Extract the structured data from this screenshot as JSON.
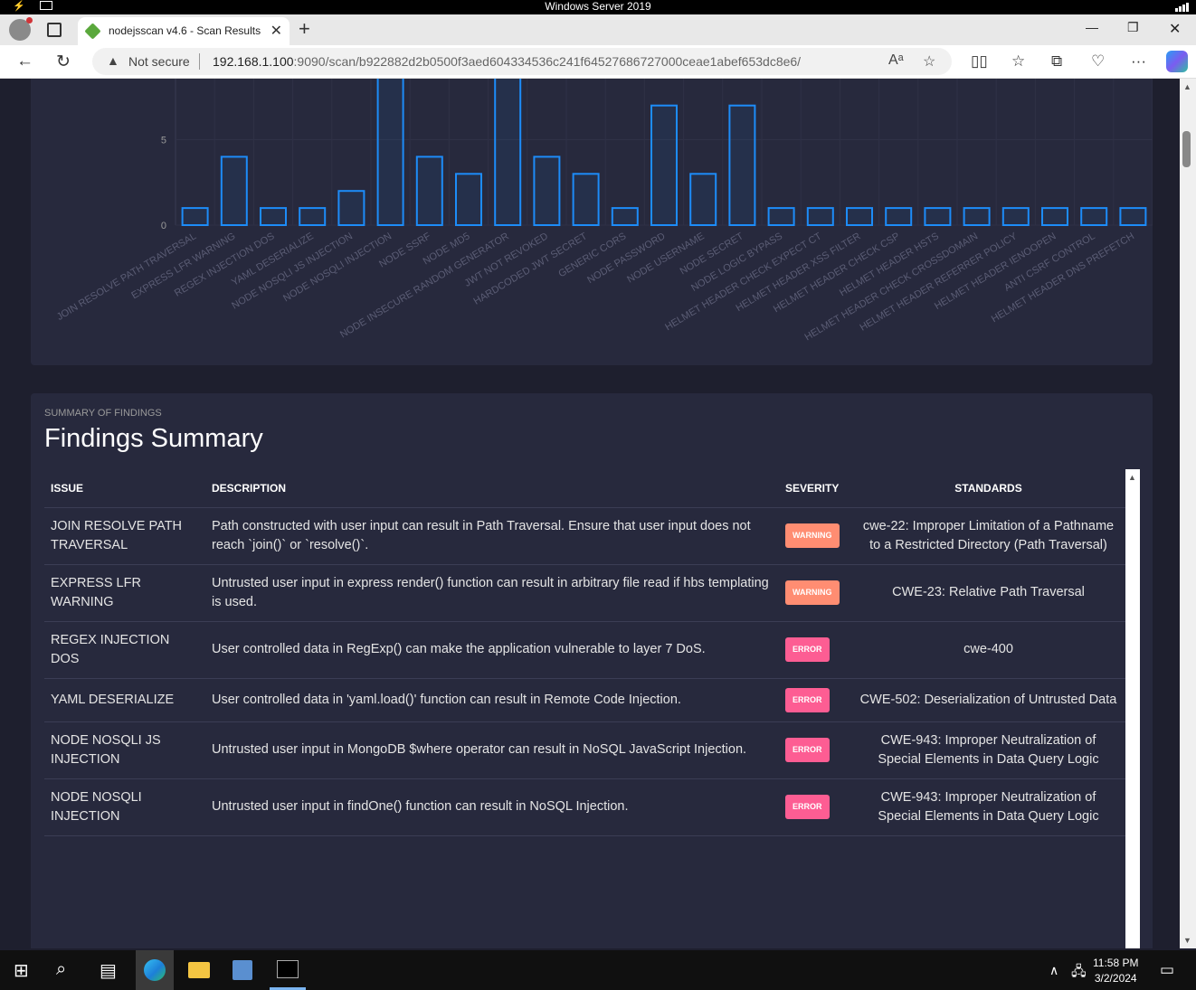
{
  "os": {
    "title": "Windows Server 2019"
  },
  "browser": {
    "tab_title": "nodejsscan v4.6 - Scan Results",
    "not_secure": "Not secure",
    "url_host": "192.168.1.100",
    "url_rest": ":9090/scan/b922882d2b0500f3aed604334536c241f64527686727000ceae1abef653dc8e6/"
  },
  "chart_data": {
    "type": "bar",
    "categories": [
      "JOIN RESOLVE PATH TRAVERSAL",
      "EXPRESS LFR WARNING",
      "REGEX INJECTION DOS",
      "YAML DESERIALIZE",
      "NODE NOSQLI JS INJECTION",
      "NODE NOSQLI INJECTION",
      "NODE SSRF",
      "NODE MD5",
      "NODE INSECURE RANDOM GENERATOR",
      "JWT NOT REVOKED",
      "HARDCODED JWT SECRET",
      "GENERIC CORS",
      "NODE PASSWORD",
      "NODE USERNAME",
      "NODE SECRET",
      "NODE LOGIC BYPASS",
      "HELMET HEADER CHECK EXPECT CT",
      "HELMET HEADER XSS FILTER",
      "HELMET HEADER CHECK CSP",
      "HELMET HEADER HSTS",
      "HELMET HEADER CHECK CROSSDOMAIN",
      "HELMET HEADER REFERRER POLICY",
      "HELMET HEADER IENOOPEN",
      "ANTI CSRF CONTROL",
      "HELMET HEADER DNS PREFETCH"
    ],
    "values": [
      1,
      4,
      1,
      1,
      2,
      9,
      4,
      3,
      9,
      4,
      3,
      1,
      7,
      3,
      7,
      1,
      1,
      1,
      1,
      1,
      1,
      1,
      1,
      1,
      1
    ],
    "y_ticks": [
      "0",
      "5"
    ],
    "ylim": [
      0,
      8.6
    ],
    "bar_color": "#1d8cf8",
    "grid": true
  },
  "summary": {
    "category": "SUMMARY OF FINDINGS",
    "title": "Findings Summary",
    "headers": {
      "issue": "ISSUE",
      "description": "DESCRIPTION",
      "severity": "SEVERITY",
      "standards": "STANDARDS"
    },
    "rows": [
      {
        "issue": "JOIN RESOLVE PATH TRAVERSAL",
        "description": "Path constructed with user input can result in Path Traversal. Ensure that user input does not reach `join()` or `resolve()`.",
        "severity": "WARNING",
        "standards": "cwe-22: Improper Limitation of a Pathname to a Restricted Directory (Path Traversal)"
      },
      {
        "issue": "EXPRESS LFR WARNING",
        "description": "Untrusted user input in express render() function can result in arbitrary file read if hbs templating is used.",
        "severity": "WARNING",
        "standards": "CWE-23: Relative Path Traversal"
      },
      {
        "issue": "REGEX INJECTION DOS",
        "description": "User controlled data in RegExp() can make the application vulnerable to layer 7 DoS.",
        "severity": "ERROR",
        "standards": "cwe-400"
      },
      {
        "issue": "YAML DESERIALIZE",
        "description": "User controlled data in 'yaml.load()' function can result in Remote Code Injection.",
        "severity": "ERROR",
        "standards": "CWE-502: Deserialization of Untrusted Data"
      },
      {
        "issue": "NODE NOSQLI JS INJECTION",
        "description": "Untrusted user input in MongoDB $where operator can result in NoSQL JavaScript Injection.",
        "severity": "ERROR",
        "standards": "CWE-943: Improper Neutralization of Special Elements in Data Query Logic"
      },
      {
        "issue": "NODE NOSQLI INJECTION",
        "description": "Untrusted user input in findOne() function can result in NoSQL Injection.",
        "severity": "ERROR",
        "standards": "CWE-943: Improper Neutralization of Special Elements in Data Query Logic"
      }
    ]
  },
  "taskbar": {
    "time": "11:58 PM",
    "date": "3/2/2024"
  }
}
